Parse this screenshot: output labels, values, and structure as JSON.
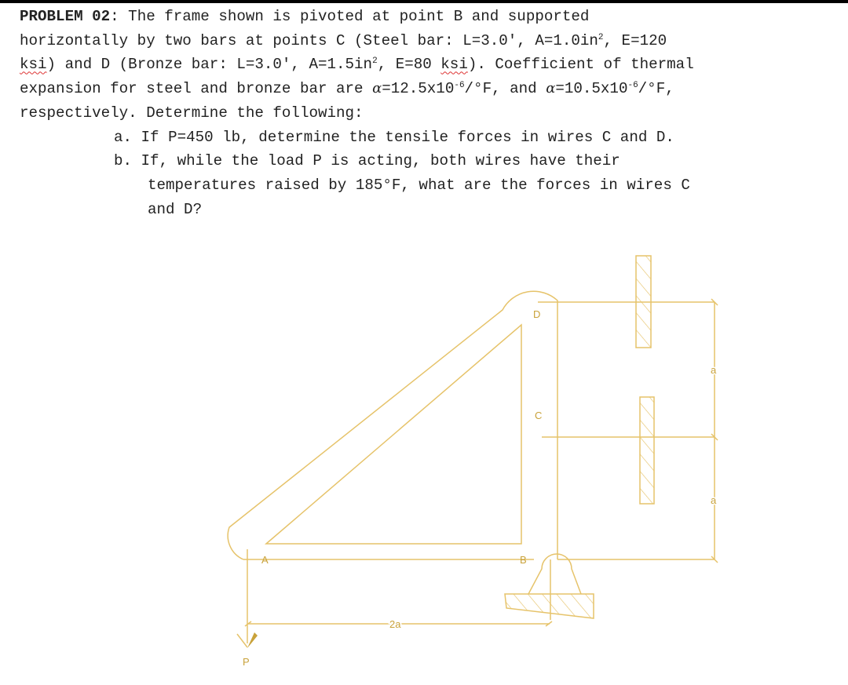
{
  "problem": {
    "heading": "PROBLEM 02",
    "lines": [
      ": The frame shown is pivoted at point B and supported",
      "horizontally by two bars at points C (Steel bar: L=3.0′, A=1.0in",
      ", E=120",
      "ksi",
      ") and D (Bronze bar: L=3.0′, A=1.5in",
      ", E=80 ",
      "ksi",
      "). Coefficient of thermal",
      "expansion for steel and bronze bar are ",
      "α",
      "=12.5x10",
      "-6",
      "/°F, and ",
      "α",
      "=10.5x10",
      "-6",
      "/°F,",
      "respectively. Determine the following:"
    ],
    "sup2": "2",
    "parts": {
      "a": "a. If P=450 lb, determine the tensile forces in wires C and D.",
      "b1": "b. If, while the load P is acting, both wires have their",
      "b2": "temperatures raised by 185°F, what are the forces in wires C",
      "b3": "and D?"
    }
  },
  "diagram": {
    "labels": {
      "A": "A",
      "B": "B",
      "C": "C",
      "D": "D",
      "P": "P",
      "dim_horizontal": "2a",
      "dim_upper": "a",
      "dim_lower": "a"
    },
    "colors": {
      "stroke": "#e6c36a",
      "label": "#c9a23a"
    },
    "bars": {
      "C": {
        "material": "Steel",
        "L": "3.0 ft",
        "A": "1.0 in^2",
        "E": "120 ksi",
        "alpha": "12.5x10^-6 /°F"
      },
      "D": {
        "material": "Bronze",
        "L": "3.0 ft",
        "A": "1.5 in^2",
        "E": "80 ksi",
        "alpha": "10.5x10^-6 /°F"
      }
    },
    "load": {
      "P": "450 lb"
    },
    "temperature_rise": "185°F"
  }
}
